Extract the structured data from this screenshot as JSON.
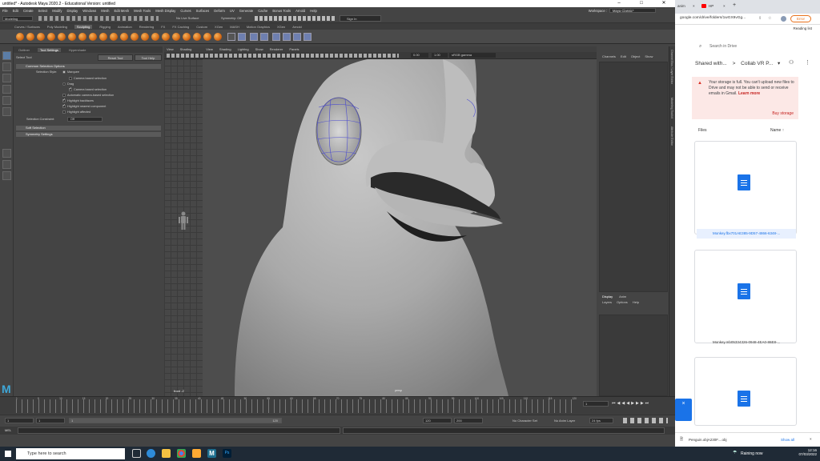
{
  "maya": {
    "title": "untitled* - Autodesk Maya 2020.2 - Educational Version: untitled",
    "menus": [
      "File",
      "Edit",
      "Create",
      "Select",
      "Modify",
      "Display",
      "Windows",
      "Mesh",
      "Edit Mesh",
      "Mesh Tools",
      "Mesh Display",
      "Curves",
      "Surfaces",
      "Deform",
      "UV",
      "Generate",
      "Cache",
      "Bonus Tools",
      "Arnold",
      "Help"
    ],
    "workspace_label": "Workspace :",
    "workspace_value": "Maya Classic*",
    "mode_select": "Modeling",
    "live_surface": "No Live Surface",
    "symmetry": "Symmetry: Off",
    "sign_in": "Sign In",
    "shelf_tabs": [
      "Curves / Surfaces",
      "Poly Modeling",
      "Sculpting",
      "Rigging",
      "Animation",
      "Rendering",
      "FX",
      "FX Caching",
      "Custom",
      "XGen",
      "MASH",
      "Motion Graphics",
      "XGen",
      "Arnold"
    ],
    "tool_settings": {
      "tabs": [
        "Outliner",
        "Tool Settings",
        "Hypershade"
      ],
      "header": "Select Tool",
      "reset": "Reset Tool",
      "help": "Tool Help",
      "section_common": "Common Selection Options",
      "selection_style_label": "Selection Style:",
      "marquee": "Marquee",
      "camera_based": "Camera based selection",
      "drag": "Drag",
      "camera_based2": "Camera based selection",
      "auto_camera": "Automatic camera-based selection",
      "highlight_backfaces": "Highlight backfaces",
      "highlight_nearest": "Highlight nearest component",
      "highlight_affected": "Highlight affected",
      "constraint_label": "Selection Constraint:",
      "constraint_value": "Off",
      "section_soft": "Soft Selection",
      "section_symmetry": "Symmetry Settings"
    },
    "viewport": {
      "menus_left": [
        "View",
        "Shading"
      ],
      "menus_right": [
        "View",
        "Shading",
        "Lighting",
        "Show",
        "Renderer",
        "Panels"
      ],
      "value1": "0.00",
      "value2": "1.00",
      "color_space": "sRGB gamma",
      "front_label": "front -Z",
      "persp_label": "persp"
    },
    "channel_box": {
      "menus": [
        "Channels",
        "Edit",
        "Object",
        "Show"
      ],
      "layer_tabs": [
        "Display",
        "Anim"
      ],
      "layer_menus": [
        "Layers",
        "Options",
        "Help"
      ]
    },
    "side_tabs": [
      "Channel Box / Layer Editor",
      "Modeling Toolkit",
      "Attribute Editor"
    ],
    "timeline": {
      "ticks": [
        "1",
        "5",
        "10",
        "15",
        "20",
        "25",
        "30",
        "35",
        "40",
        "45",
        "50",
        "55",
        "60",
        "65",
        "70",
        "75",
        "80",
        "85",
        "90",
        "95",
        "100",
        "105",
        "110",
        "115",
        "120"
      ],
      "current": "1"
    },
    "range": {
      "start": "1",
      "start2": "1",
      "inner_start": "1",
      "inner_end": "120",
      "end1": "120",
      "end2": "200",
      "character": "No Character Set",
      "anim_layer": "No Anim Layer",
      "fps": "24 fps"
    },
    "command_label": "MEL"
  },
  "browser": {
    "tabs": [
      {
        "label": "anim"
      },
      {
        "label": "HP"
      }
    ],
    "url": "google.com/drive/folders/1wGX9vGg...",
    "profile": "Error",
    "reading_list": "Reading list",
    "search_placeholder": "Search in Drive",
    "breadcrumb_a": "Shared with...",
    "breadcrumb_b": "Collab VR P...",
    "storage_msg": "Your storage is full. You can't upload new files to Drive and may not be able to send or receive emails in Gmail.",
    "learn_more": "Learn more",
    "buy_storage": "Buy storage",
    "files_label": "Files",
    "sort_label": "Name",
    "files": [
      {
        "name": "Monkey.fbx701AE385-9D57-4866-6348-..."
      },
      {
        "name": "Monkey.mb05334326-0948-4EA0-86E8-..."
      },
      {
        "name": ""
      }
    ],
    "download_name": "Penguin.objA230F....obj",
    "show_all": "Show all"
  },
  "taskbar": {
    "search_placeholder": "Type here to search",
    "weather": "Raining now",
    "time": "12:16",
    "date": "07/03/2022"
  },
  "colors": {
    "maya_bg": "#444444",
    "accent_blue": "#1a73e8",
    "warning_bg": "#fce8e6",
    "warning_red": "#c5221f"
  }
}
